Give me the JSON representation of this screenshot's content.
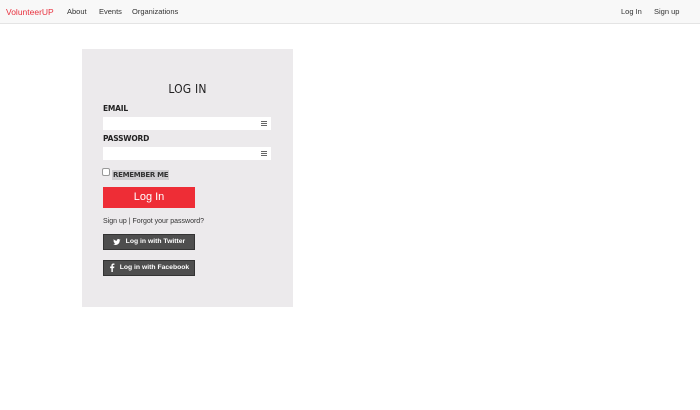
{
  "navbar": {
    "brand": "VolunteerUP",
    "links": [
      "About",
      "Events",
      "Organizations"
    ],
    "right_links": [
      "Log In",
      "Sign up"
    ]
  },
  "form": {
    "title": "LOG IN",
    "email_label": "EMAIL",
    "email_value": "",
    "password_label": "PASSWORD",
    "password_value": "",
    "remember_label": "REMEMBER ME",
    "submit_label": "Log In",
    "signup_link": "Sign up",
    "separator": "|",
    "forgot_link": "Forgot your password?",
    "twitter_label": "Log in with Twitter",
    "facebook_label": "Log in with Facebook"
  },
  "colors": {
    "brand": "#e8323f",
    "primary_button": "#ee2d36",
    "social_button": "#4e4e4e",
    "panel_bg": "#eceaec"
  },
  "icons": {
    "twitter": "twitter-bird-icon",
    "facebook": "facebook-f-icon",
    "field_menu": "menu-lines-icon"
  }
}
